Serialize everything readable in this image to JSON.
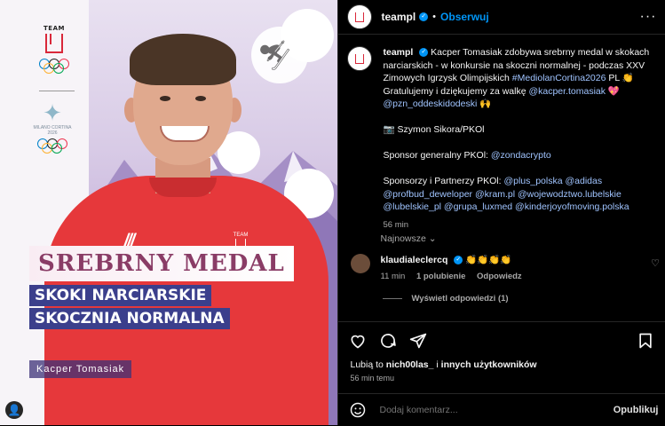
{
  "image": {
    "team_label": "TEAM",
    "milan_label": "MILANO CORTINA",
    "milan_year": "2026",
    "title": "SREBRNY MEDAL",
    "subtitle1": "SKOKI NARCIARSKIE",
    "subtitle2": "SKOCZNIA NORMALNA",
    "athlete": "Kacper Tomasiak"
  },
  "header": {
    "username": "teampl",
    "separator": "•",
    "follow_label": "Obserwuj",
    "more": "···"
  },
  "caption": {
    "username": "teampl",
    "text1": "Kacper Tomasiak zdobywa srebrny medal w skokach narciarskich - w konkursie na skoczni normalnej - podczas XXV Zimowych Igrzysk Olimpijskich ",
    "hashtag": "#MediolanCortina2026",
    "flag": " PL 👏",
    "text2": "Gratulujemy i dziękujemy za walkę ",
    "mention1": "@kacper.tomasiak",
    "heart": " 💖",
    "mention2": "@pzn_oddeskidodeski",
    "hands": " 🙌",
    "photo": "📷 Szymon Sikora/PKOl",
    "sponsor_gen": "Sponsor generalny PKOl: ",
    "sponsor_gen_link": "@zondacrypto",
    "partners": "Sponsorzy i Partnerzy PKOl: ",
    "partner_links": "@plus_polska @adidas @profbud_deweloper @kram.pl @wojewodztwo.lubelskie @lubelskie_pl @grupa_luxmed @kinderjoyofmoving.polska",
    "time": "56 min"
  },
  "sort_label": "Najnowsze ⌄",
  "comment": {
    "username": "klaudialeclercq",
    "text": "👏👏👏👏",
    "time": "11 min",
    "likes": "1 polubienie",
    "reply": "Odpowiedz",
    "view_replies": "Wyświetl odpowiedzi (1)"
  },
  "likes": {
    "prefix": "Lubią to ",
    "user": "nich00las_",
    "middle": " i ",
    "others": "innych użytkowników"
  },
  "post_time": "56 min temu",
  "comment_input": {
    "placeholder": "Dodaj komentarz..."
  },
  "publish_label": "Opublikuj",
  "colors": {
    "accent": "#0095f6",
    "sweater": "#e6383b",
    "banner": "#3b3f8c"
  }
}
